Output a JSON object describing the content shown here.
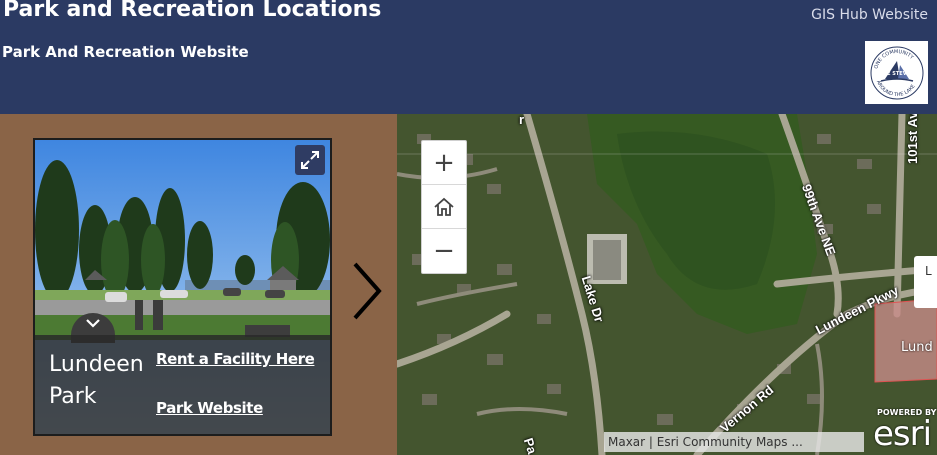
{
  "header": {
    "title": "Park and Recreation Locations",
    "subtitle": "Park And Recreation Website",
    "hub_link": "GIS Hub Website",
    "logo": {
      "icon": "lake-stevens-logo",
      "arc_text_top": "ONE COMMUNITY",
      "arc_text_bottom": "AROUND THE LAKE",
      "center_text": "LAKE STEVENS"
    }
  },
  "card": {
    "park_name": "Lundeen Park",
    "rent_link": "Rent a Facility Here",
    "website_link": "Park Website",
    "expand_icon": "expand-icon",
    "collapse_icon": "chevron-down-icon"
  },
  "carousel": {
    "next_icon": "chevron-right-icon"
  },
  "map": {
    "zoom_in": "+",
    "zoom_out": "−",
    "home_icon": "home-icon",
    "road_labels": {
      "lake_dr": "Lake Dr",
      "ave_99": "99th Ave NE",
      "ave_101": "101st Ave NE",
      "lundeen_pkwy": "Lundeen Pkwy",
      "vernon_rd": "Vernon Rd",
      "top_partial": "r",
      "bottom_partial": "Pa"
    },
    "polygon_label": "Lund",
    "popup_partial": "L",
    "attribution": "Maxar | Esri Community Maps ...",
    "powered_by": "POWERED BY",
    "esri": "esri"
  }
}
